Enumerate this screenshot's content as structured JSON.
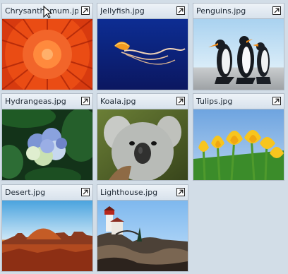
{
  "gallery": {
    "items": [
      {
        "title": "Chrysanthemum.jpg",
        "subject": "chrysanthemum",
        "open_icon": "external-open-icon"
      },
      {
        "title": "Jellyfish.jpg",
        "subject": "jellyfish",
        "open_icon": "external-open-icon"
      },
      {
        "title": "Penguins.jpg",
        "subject": "penguins",
        "open_icon": "external-open-icon"
      },
      {
        "title": "Hydrangeas.jpg",
        "subject": "hydrangeas",
        "open_icon": "external-open-icon"
      },
      {
        "title": "Koala.jpg",
        "subject": "koala",
        "open_icon": "external-open-icon"
      },
      {
        "title": "Tulips.jpg",
        "subject": "tulips",
        "open_icon": "external-open-icon"
      },
      {
        "title": "Desert.jpg",
        "subject": "desert",
        "open_icon": "external-open-icon"
      },
      {
        "title": "Lighthouse.jpg",
        "subject": "lighthouse",
        "open_icon": "external-open-icon"
      }
    ]
  },
  "colors": {
    "background": "#d2dde7",
    "header_top": "#eef3f8",
    "header_bottom": "#d8e2ec",
    "border": "#b3bdc8"
  }
}
